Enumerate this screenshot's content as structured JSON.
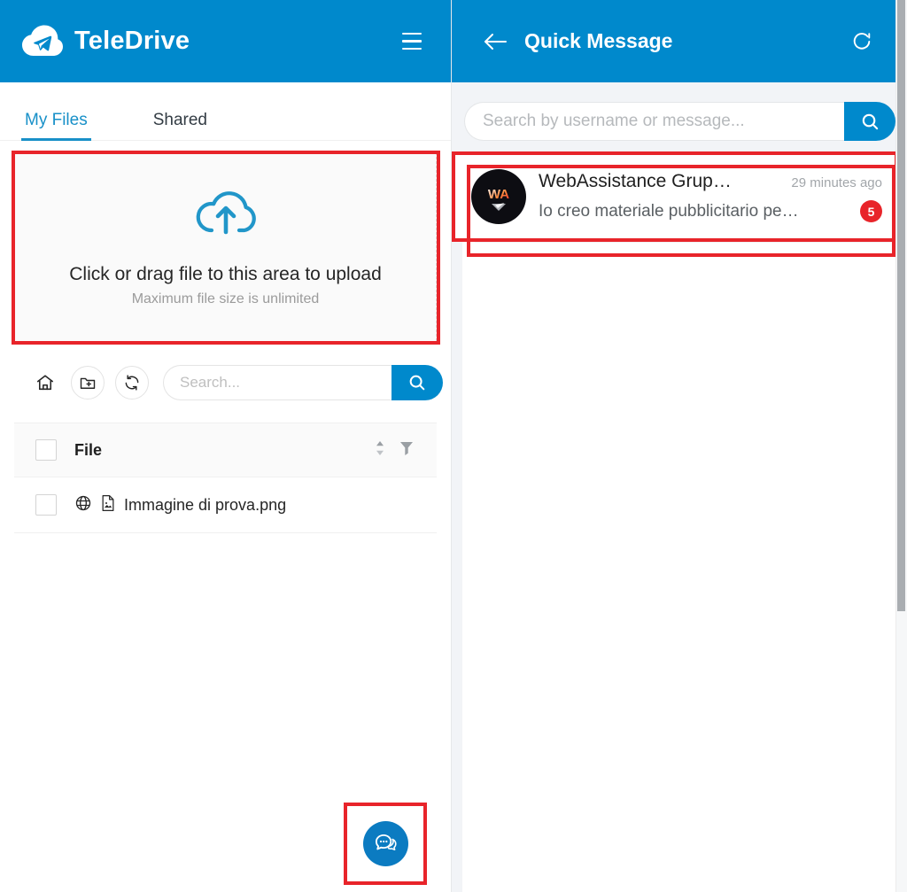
{
  "app": {
    "brand_name": "TeleDrive",
    "accent_blue": "#0089cc",
    "highlight_red": "#e8242a"
  },
  "left_panel": {
    "header": {
      "logo_icon": "cloud-paper-plane-logo",
      "menu_icon": "hamburger-menu-icon"
    },
    "tabs": [
      {
        "label": "My Files",
        "active": true
      },
      {
        "label": "Shared",
        "active": false
      }
    ],
    "dropzone": {
      "icon": "cloud-upload-icon",
      "title": "Click or drag file to this area to upload",
      "hint": "Maximum file size is unlimited"
    },
    "toolbar": {
      "home_icon": "home-icon",
      "new_folder_icon": "folder-add-icon",
      "refresh_icon": "refresh-icon",
      "search_placeholder": "Search...",
      "search_value": "",
      "search_icon": "search-icon"
    },
    "file_table": {
      "select_all_checkbox": false,
      "columns": [
        "File"
      ],
      "sort_icon": "sort-updown-icon",
      "filter_icon": "filter-icon",
      "rows": [
        {
          "checked": false,
          "globe_icon": "globe-icon",
          "file_icon": "image-file-icon",
          "name": "Immagine di prova.png"
        }
      ]
    },
    "fab": {
      "icon": "chat-bubble-icon"
    }
  },
  "right_panel": {
    "header": {
      "back_icon": "arrow-left-icon",
      "title": "Quick Message",
      "refresh_icon": "refresh-icon"
    },
    "search": {
      "placeholder": "Search by username or message...",
      "value": "",
      "icon": "search-icon"
    },
    "messages": [
      {
        "avatar_label": "WA",
        "avatar_icon": "webassistance-avatar",
        "title": "WebAssistance Grup…",
        "time": "29 minutes ago",
        "preview": "Io creo materiale pubblicitario pe…",
        "unread_count": "5"
      }
    ],
    "scrollbar": {
      "vertical_icon": "vertical-scrollbar"
    }
  }
}
